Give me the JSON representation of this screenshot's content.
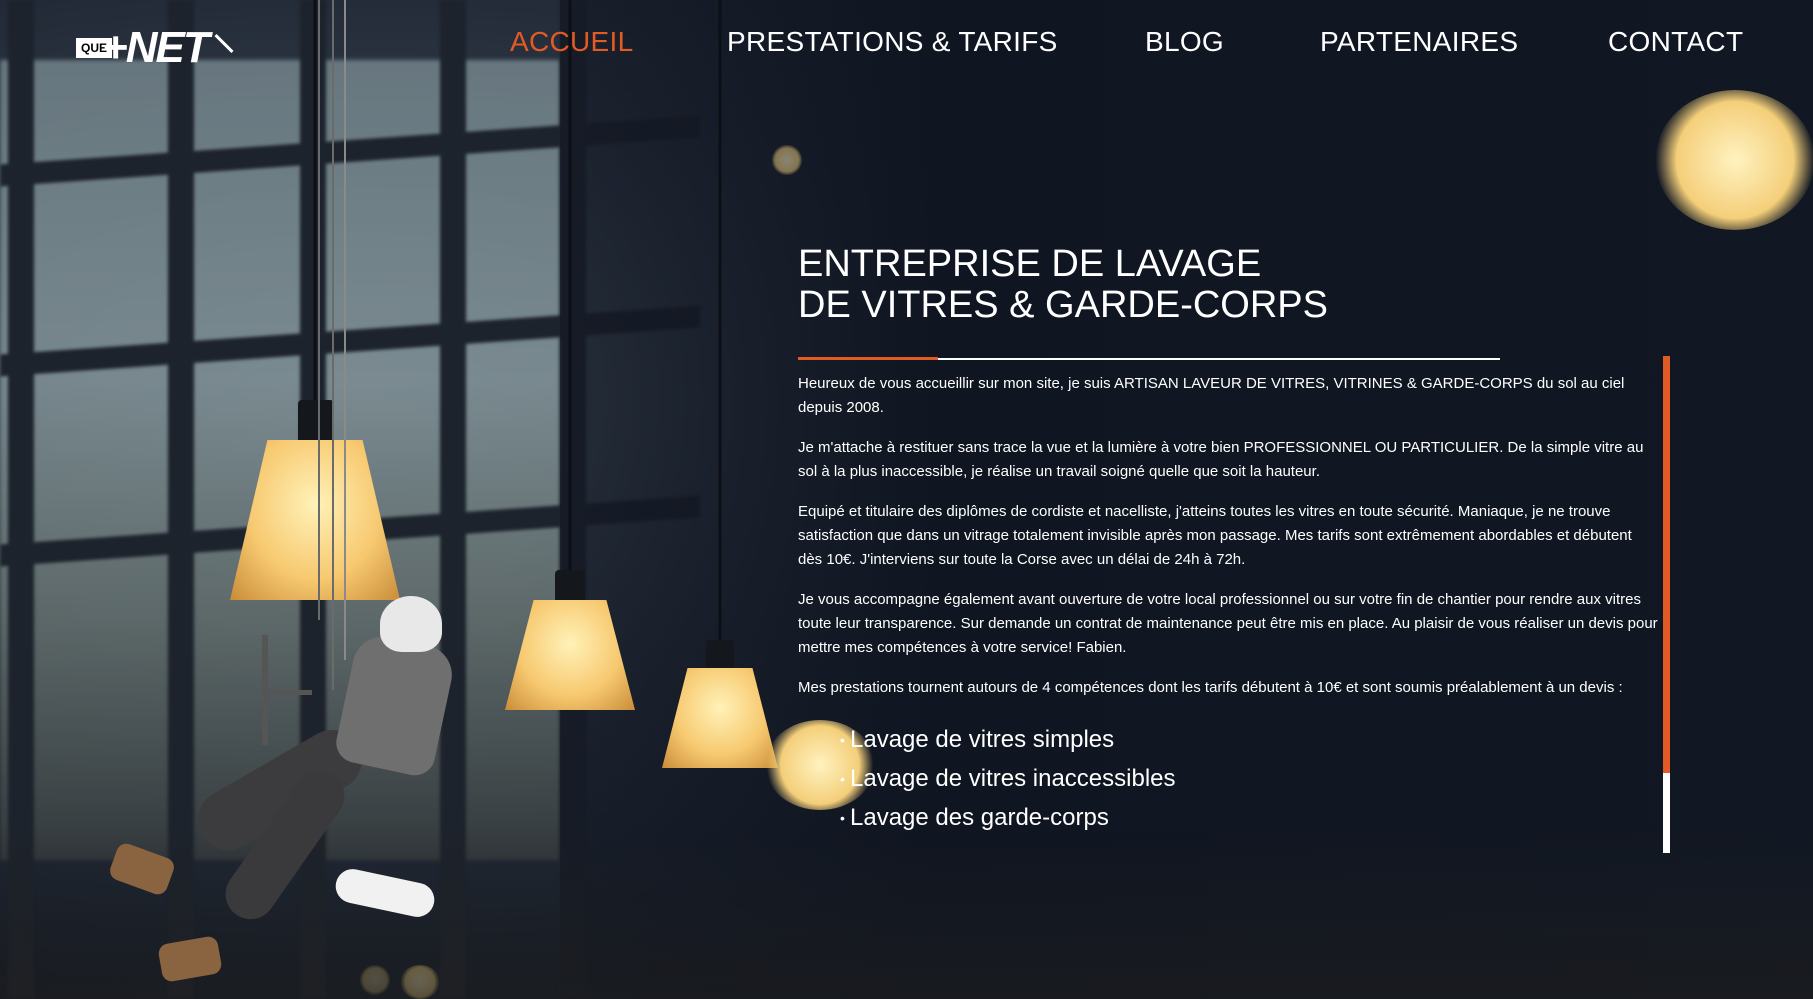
{
  "brand": {
    "logo_small": "QUE",
    "logo_large": "NET",
    "accent_color": "#e25a24"
  },
  "nav": {
    "items": [
      {
        "label": "ACCUEIL",
        "active": true
      },
      {
        "label": "PRESTATIONS & TARIFS",
        "active": false
      },
      {
        "label": "BLOG",
        "active": false
      },
      {
        "label": "PARTENAIRES",
        "active": false
      },
      {
        "label": "CONTACT",
        "active": false
      }
    ]
  },
  "main": {
    "title_line1": "ENTREPRISE DE LAVAGE",
    "title_line2": "DE VITRES & GARDE-CORPS",
    "paragraphs": [
      "Heureux de vous accueillir sur mon site, je suis ARTISAN LAVEUR DE VITRES, VITRINES & GARDE-CORPS du sol au ciel depuis 2008.",
      "Je m'attache à restituer sans trace la vue et la lumière à votre bien PROFESSIONNEL OU PARTICULIER. De la simple vitre au sol à la plus inaccessible, je réalise un travail soigné quelle que soit la hauteur.",
      "Equipé et titulaire des diplômes de cordiste et nacelliste, j'atteins toutes les vitres en toute sécurité. Maniaque, je ne trouve satisfaction que dans un vitrage totalement invisible après mon passage. Mes tarifs sont extrêmement abordables et débutent dès 10€. J'interviens sur toute la Corse avec un délai de 24h à 72h.",
      "Je vous accompagne également avant ouverture de votre local professionnel ou sur votre fin de chantier pour rendre aux vitres toute leur transparence. Sur demande un contrat de maintenance peut être mis en place. Au plaisir de vous réaliser un devis pour mettre mes compétences à votre service! Fabien.",
      "Mes prestations tournent autours de 4 compétences dont les tarifs débutent à 10€ et sont soumis préalablement à un devis :"
    ],
    "services": [
      "Lavage de vitres simples",
      "Lavage de vitres inaccessibles",
      "Lavage des garde-corps"
    ],
    "scroll_position": 0.84
  },
  "icons": [
    "logo-icon",
    "squeegee-icon"
  ]
}
